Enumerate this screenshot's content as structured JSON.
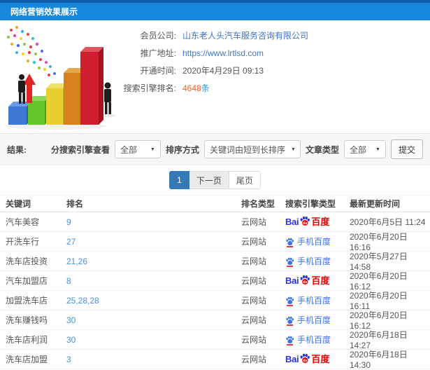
{
  "header": {
    "title": "网络营销效果展示"
  },
  "info": {
    "rows": [
      {
        "label": "会员公司:",
        "value": "山东老人头汽车服务咨询有限公司"
      },
      {
        "label": "推广地址:",
        "value": "https://www.lrtlsd.com"
      },
      {
        "label": "开通时间:",
        "value": "2020年4月29日  09:13"
      },
      {
        "label": "搜索引擎排名:",
        "value": "4648",
        "suffix": "条"
      }
    ]
  },
  "filters": {
    "section_label": "结果:",
    "engine_label": "分搜索引擎查看",
    "engine_value": "全部",
    "sort_label": "排序方式",
    "sort_value": "关键词由短到长排序",
    "article_label": "文章类型",
    "article_value": "全部",
    "submit_label": "提交",
    "caret": "▼"
  },
  "pagination": {
    "current": "1",
    "next": "下一页",
    "last": "尾页"
  },
  "table": {
    "headers": [
      "关键词",
      "排名",
      "排名类型",
      "搜索引擎类型",
      "最新更新时间"
    ],
    "engine_logos": {
      "baidu": {
        "prefix": "Bai",
        "du": "du",
        "suffix": "百度"
      },
      "shouji": {
        "text": "手机百度"
      }
    },
    "rows": [
      {
        "keyword": "汽车美容",
        "rank": "9",
        "rank_type": "云网站",
        "engine": "baidu",
        "updated": "2020年6月5日 11:24"
      },
      {
        "keyword": "开洗车行",
        "rank": "27",
        "rank_type": "云网站",
        "engine": "shouji",
        "updated": "2020年6月20日 16:16"
      },
      {
        "keyword": "洗车店投资",
        "rank": "21,26",
        "rank_type": "云网站",
        "engine": "shouji",
        "updated": "2020年5月27日 14:58"
      },
      {
        "keyword": "汽车加盟店",
        "rank": "8",
        "rank_type": "云网站",
        "engine": "baidu",
        "updated": "2020年6月20日 16:12"
      },
      {
        "keyword": "加盟洗车店",
        "rank": "25,28,28",
        "rank_type": "云网站",
        "engine": "shouji",
        "updated": "2020年6月20日 16:11"
      },
      {
        "keyword": "洗车赚钱吗",
        "rank": "30",
        "rank_type": "云网站",
        "engine": "shouji",
        "updated": "2020年6月20日 16:12"
      },
      {
        "keyword": "洗车店利润",
        "rank": "30",
        "rank_type": "云网站",
        "engine": "shouji",
        "updated": "2020年6月18日 14:27"
      },
      {
        "keyword": "洗车店加盟",
        "rank": "3",
        "rank_type": "云网站",
        "engine": "baidu",
        "updated": "2020年6月18日 14:30"
      }
    ]
  },
  "colors": {
    "topbar_blue": "#1687d9",
    "topbar_dark_strip": "#0a5da6",
    "link_blue": "#3f74c8",
    "rank_link_blue": "#4a90d9",
    "highlight_orange": "#ff5a22",
    "unit_blue": "#2e9be8",
    "pagination_active": "#337ab7",
    "baidu_blue": "#2932e1",
    "baidu_red": "#e10601",
    "mobile_baidu_blue": "#3b76e8"
  }
}
